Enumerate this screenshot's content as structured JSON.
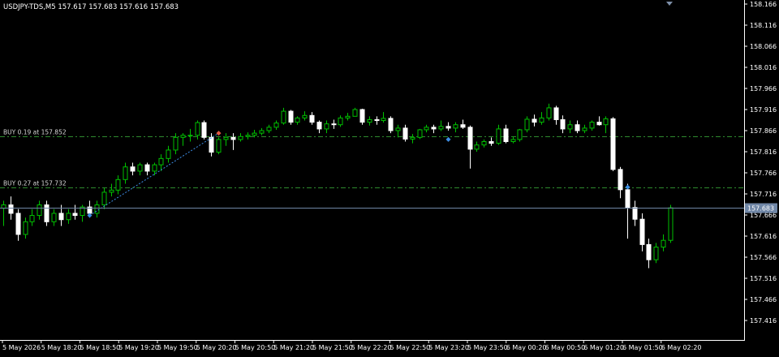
{
  "header": {
    "symbol_label": "USDJPY-TDS,M5  157.617 157.683 157.616 157.683"
  },
  "orders": [
    {
      "label": "BUY 0.19 at 157.852",
      "price": 157.852
    },
    {
      "label": "BUY 0.27 at 157.732",
      "price": 157.732
    }
  ],
  "current_price": {
    "value": 157.683,
    "label": "157.683"
  },
  "colors": {
    "background": "#000000",
    "bull_body": "#000000",
    "bull_outline": "#00c000",
    "bear_body": "#ffffff",
    "axis": "#ffffff",
    "order_line": "#2e8b2e",
    "price_line": "#6f86a6",
    "buy_marker": "#3d8ee6",
    "sell_marker": "#e45a45"
  },
  "chart_data": {
    "type": "candlestick",
    "symbol": "USDJPY-TDS",
    "timeframe": "M5",
    "ylim": [
      157.391,
      158.166
    ],
    "y_ticks": [
      "158.166",
      "158.116",
      "158.066",
      "158.016",
      "157.966",
      "157.916",
      "157.866",
      "157.816",
      "157.766",
      "157.716",
      "157.666",
      "157.616",
      "157.566",
      "157.516",
      "157.466",
      "157.416"
    ],
    "x_ticks": [
      "5 May 2026",
      "5 May 18:20",
      "5 May 18:50",
      "5 May 19:20",
      "5 May 19:50",
      "5 May 20:20",
      "5 May 20:50",
      "5 May 21:20",
      "5 May 21:50",
      "5 May 22:20",
      "5 May 22:50",
      "5 May 23:20",
      "5 May 23:50",
      "6 May 00:20",
      "6 May 00:50",
      "6 May 01:20",
      "6 May 01:50",
      "6 May 02:20"
    ],
    "ohlc": [
      [
        157.682,
        157.7,
        157.64,
        157.69
      ],
      [
        157.69,
        157.71,
        157.655,
        157.67
      ],
      [
        157.67,
        157.68,
        157.605,
        157.62
      ],
      [
        157.62,
        157.66,
        157.61,
        157.65
      ],
      [
        157.65,
        157.68,
        157.64,
        157.665
      ],
      [
        157.665,
        157.7,
        157.655,
        157.69
      ],
      [
        157.69,
        157.7,
        157.64,
        157.65
      ],
      [
        157.65,
        157.68,
        157.64,
        157.67
      ],
      [
        157.67,
        157.69,
        157.64,
        157.655
      ],
      [
        157.655,
        157.68,
        157.645,
        157.67
      ],
      [
        157.67,
        157.69,
        157.655,
        157.665
      ],
      [
        157.665,
        157.69,
        157.65,
        157.685
      ],
      [
        157.685,
        157.7,
        157.66,
        157.67
      ],
      [
        157.67,
        157.7,
        157.66,
        157.69
      ],
      [
        157.69,
        157.73,
        157.68,
        157.72
      ],
      [
        157.72,
        157.74,
        157.71,
        157.725
      ],
      [
        157.725,
        157.76,
        157.715,
        157.75
      ],
      [
        157.75,
        157.79,
        157.74,
        157.78
      ],
      [
        157.78,
        157.79,
        157.76,
        157.77
      ],
      [
        157.77,
        157.79,
        157.76,
        157.785
      ],
      [
        157.785,
        157.79,
        157.76,
        157.77
      ],
      [
        157.77,
        157.79,
        157.76,
        157.785
      ],
      [
        157.785,
        157.81,
        157.77,
        157.8
      ],
      [
        157.8,
        157.83,
        157.79,
        157.82
      ],
      [
        157.82,
        157.86,
        157.81,
        157.85
      ],
      [
        157.85,
        157.86,
        157.83,
        157.855
      ],
      [
        157.855,
        157.87,
        157.84,
        157.855
      ],
      [
        157.855,
        157.89,
        157.845,
        157.885
      ],
      [
        157.885,
        157.89,
        157.845,
        157.85
      ],
      [
        157.85,
        157.86,
        157.805,
        157.815
      ],
      [
        157.815,
        157.85,
        157.81,
        157.845
      ],
      [
        157.845,
        157.86,
        157.83,
        157.85
      ],
      [
        157.85,
        157.86,
        157.82,
        157.845
      ],
      [
        157.845,
        157.86,
        157.84,
        157.852
      ],
      [
        157.852,
        157.862,
        157.845,
        157.855
      ],
      [
        157.855,
        157.868,
        157.85,
        157.86
      ],
      [
        157.86,
        157.872,
        157.855,
        157.866
      ],
      [
        157.866,
        157.88,
        157.86,
        157.874
      ],
      [
        157.874,
        157.89,
        157.868,
        157.884
      ],
      [
        157.884,
        157.92,
        157.88,
        157.912
      ],
      [
        157.912,
        157.915,
        157.88,
        157.886
      ],
      [
        157.886,
        157.9,
        157.88,
        157.896
      ],
      [
        157.896,
        157.912,
        157.89,
        157.902
      ],
      [
        157.902,
        157.91,
        157.88,
        157.886
      ],
      [
        157.886,
        157.89,
        157.86,
        157.87
      ],
      [
        157.87,
        157.89,
        157.86,
        157.882
      ],
      [
        157.882,
        157.892,
        157.87,
        157.88
      ],
      [
        157.88,
        157.902,
        157.875,
        157.896
      ],
      [
        157.896,
        157.908,
        157.89,
        157.9
      ],
      [
        157.9,
        157.92,
        157.9,
        157.916
      ],
      [
        157.916,
        157.918,
        157.88,
        157.886
      ],
      [
        157.886,
        157.9,
        157.878,
        157.892
      ],
      [
        157.892,
        157.9,
        157.88,
        157.89
      ],
      [
        157.89,
        157.91,
        157.885,
        157.895
      ],
      [
        157.895,
        157.9,
        157.86,
        157.866
      ],
      [
        157.866,
        157.88,
        157.85,
        157.872
      ],
      [
        157.872,
        157.88,
        157.84,
        157.846
      ],
      [
        157.846,
        157.858,
        157.836,
        157.85
      ],
      [
        157.85,
        157.87,
        157.846,
        157.868
      ],
      [
        157.868,
        157.88,
        157.862,
        157.874
      ],
      [
        157.874,
        157.88,
        157.86,
        157.87
      ],
      [
        157.87,
        157.89,
        157.865,
        157.876
      ],
      [
        157.876,
        157.886,
        157.866,
        157.872
      ],
      [
        157.872,
        157.886,
        157.862,
        157.88
      ],
      [
        157.88,
        157.892,
        157.87,
        157.874
      ],
      [
        157.874,
        157.878,
        157.776,
        157.822
      ],
      [
        157.822,
        157.84,
        157.816,
        157.832
      ],
      [
        157.832,
        157.845,
        157.826,
        157.84
      ],
      [
        157.84,
        157.85,
        157.83,
        157.836
      ],
      [
        157.836,
        157.88,
        157.832,
        157.87
      ],
      [
        157.87,
        157.88,
        157.836,
        157.84
      ],
      [
        157.84,
        157.852,
        157.836,
        157.845
      ],
      [
        157.845,
        157.87,
        157.84,
        157.868
      ],
      [
        157.868,
        157.9,
        157.862,
        157.893
      ],
      [
        157.893,
        157.904,
        157.876,
        157.886
      ],
      [
        157.886,
        157.91,
        157.88,
        157.896
      ],
      [
        157.896,
        157.93,
        157.89,
        157.92
      ],
      [
        157.92,
        157.925,
        157.88,
        157.892
      ],
      [
        157.892,
        157.902,
        157.86,
        157.87
      ],
      [
        157.87,
        157.89,
        157.86,
        157.88
      ],
      [
        157.88,
        157.89,
        157.86,
        157.866
      ],
      [
        157.866,
        157.88,
        157.86,
        157.872
      ],
      [
        157.872,
        157.89,
        157.866,
        157.886
      ],
      [
        157.886,
        157.9,
        157.878,
        157.88
      ],
      [
        157.88,
        157.9,
        157.86,
        157.894
      ],
      [
        157.894,
        157.898,
        157.77,
        157.774
      ],
      [
        157.774,
        157.78,
        157.706,
        157.726
      ],
      [
        157.726,
        157.74,
        157.61,
        157.684
      ],
      [
        157.684,
        157.7,
        157.64,
        157.656
      ],
      [
        157.656,
        157.67,
        157.58,
        157.596
      ],
      [
        157.596,
        157.61,
        157.54,
        157.56
      ],
      [
        157.56,
        157.6,
        157.552,
        157.59
      ],
      [
        157.59,
        157.62,
        157.58,
        157.606
      ],
      [
        157.606,
        157.69,
        157.6,
        157.683
      ]
    ]
  }
}
